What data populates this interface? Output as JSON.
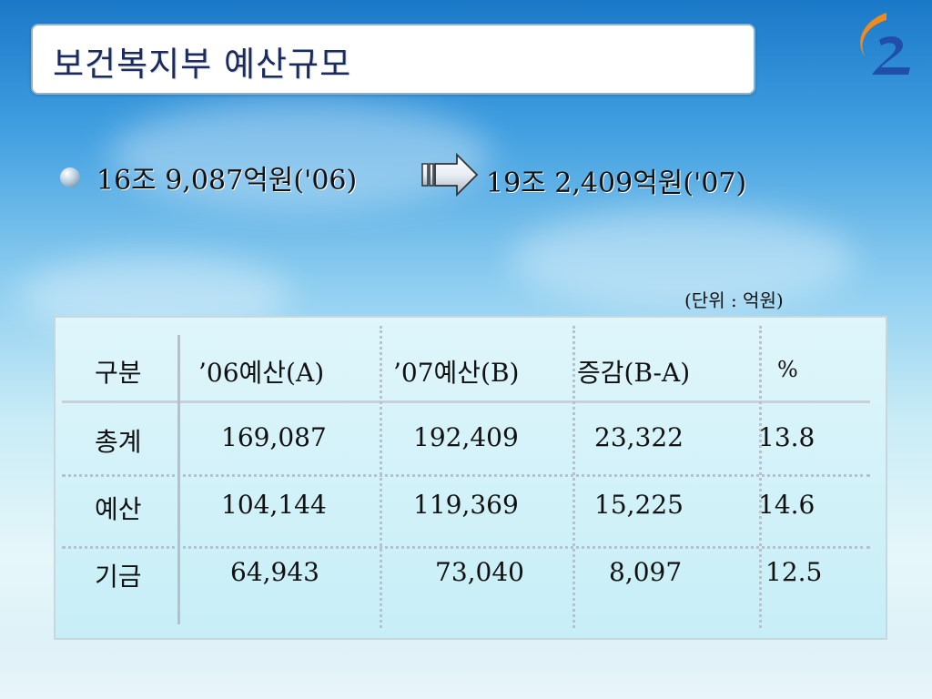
{
  "slide": {
    "title": "보건복지부 예산규모",
    "logo_text": "2"
  },
  "summary": {
    "from_text": "16조 9,087억원('06)",
    "to_text": "19조 2,409억원('07)",
    "arrow_icon": "right-arrow-icon"
  },
  "unit_note": "(단위 : 억원)",
  "table": {
    "headers": [
      "구분",
      "’06예산(A)",
      "’07예산(B)",
      "증감(B-A)",
      "%"
    ],
    "rows": [
      [
        "총계",
        "169,087",
        "192,409",
        "23,322",
        "13.8"
      ],
      [
        "예산",
        "104,144",
        "119,369",
        "15,225",
        "14.6"
      ],
      [
        "기금",
        "64,943",
        "73,040",
        "8,097",
        "12.5"
      ]
    ]
  },
  "colors": {
    "title_text": "#1c2b5a",
    "logo_orange": "#f08a1c",
    "logo_blue": "#1f4fa8"
  }
}
